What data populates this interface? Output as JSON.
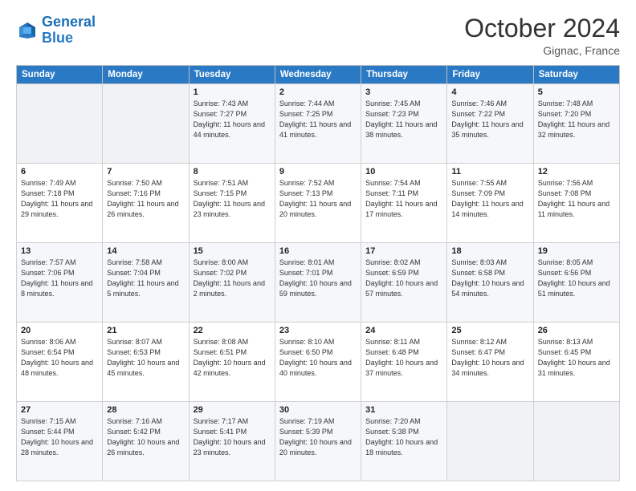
{
  "header": {
    "logo_line1": "General",
    "logo_line2": "Blue",
    "month": "October 2024",
    "location": "Gignac, France"
  },
  "columns": [
    "Sunday",
    "Monday",
    "Tuesday",
    "Wednesday",
    "Thursday",
    "Friday",
    "Saturday"
  ],
  "weeks": [
    [
      {
        "day": "",
        "info": ""
      },
      {
        "day": "",
        "info": ""
      },
      {
        "day": "1",
        "info": "Sunrise: 7:43 AM\nSunset: 7:27 PM\nDaylight: 11 hours and 44 minutes."
      },
      {
        "day": "2",
        "info": "Sunrise: 7:44 AM\nSunset: 7:25 PM\nDaylight: 11 hours and 41 minutes."
      },
      {
        "day": "3",
        "info": "Sunrise: 7:45 AM\nSunset: 7:23 PM\nDaylight: 11 hours and 38 minutes."
      },
      {
        "day": "4",
        "info": "Sunrise: 7:46 AM\nSunset: 7:22 PM\nDaylight: 11 hours and 35 minutes."
      },
      {
        "day": "5",
        "info": "Sunrise: 7:48 AM\nSunset: 7:20 PM\nDaylight: 11 hours and 32 minutes."
      }
    ],
    [
      {
        "day": "6",
        "info": "Sunrise: 7:49 AM\nSunset: 7:18 PM\nDaylight: 11 hours and 29 minutes."
      },
      {
        "day": "7",
        "info": "Sunrise: 7:50 AM\nSunset: 7:16 PM\nDaylight: 11 hours and 26 minutes."
      },
      {
        "day": "8",
        "info": "Sunrise: 7:51 AM\nSunset: 7:15 PM\nDaylight: 11 hours and 23 minutes."
      },
      {
        "day": "9",
        "info": "Sunrise: 7:52 AM\nSunset: 7:13 PM\nDaylight: 11 hours and 20 minutes."
      },
      {
        "day": "10",
        "info": "Sunrise: 7:54 AM\nSunset: 7:11 PM\nDaylight: 11 hours and 17 minutes."
      },
      {
        "day": "11",
        "info": "Sunrise: 7:55 AM\nSunset: 7:09 PM\nDaylight: 11 hours and 14 minutes."
      },
      {
        "day": "12",
        "info": "Sunrise: 7:56 AM\nSunset: 7:08 PM\nDaylight: 11 hours and 11 minutes."
      }
    ],
    [
      {
        "day": "13",
        "info": "Sunrise: 7:57 AM\nSunset: 7:06 PM\nDaylight: 11 hours and 8 minutes."
      },
      {
        "day": "14",
        "info": "Sunrise: 7:58 AM\nSunset: 7:04 PM\nDaylight: 11 hours and 5 minutes."
      },
      {
        "day": "15",
        "info": "Sunrise: 8:00 AM\nSunset: 7:02 PM\nDaylight: 11 hours and 2 minutes."
      },
      {
        "day": "16",
        "info": "Sunrise: 8:01 AM\nSunset: 7:01 PM\nDaylight: 10 hours and 59 minutes."
      },
      {
        "day": "17",
        "info": "Sunrise: 8:02 AM\nSunset: 6:59 PM\nDaylight: 10 hours and 57 minutes."
      },
      {
        "day": "18",
        "info": "Sunrise: 8:03 AM\nSunset: 6:58 PM\nDaylight: 10 hours and 54 minutes."
      },
      {
        "day": "19",
        "info": "Sunrise: 8:05 AM\nSunset: 6:56 PM\nDaylight: 10 hours and 51 minutes."
      }
    ],
    [
      {
        "day": "20",
        "info": "Sunrise: 8:06 AM\nSunset: 6:54 PM\nDaylight: 10 hours and 48 minutes."
      },
      {
        "day": "21",
        "info": "Sunrise: 8:07 AM\nSunset: 6:53 PM\nDaylight: 10 hours and 45 minutes."
      },
      {
        "day": "22",
        "info": "Sunrise: 8:08 AM\nSunset: 6:51 PM\nDaylight: 10 hours and 42 minutes."
      },
      {
        "day": "23",
        "info": "Sunrise: 8:10 AM\nSunset: 6:50 PM\nDaylight: 10 hours and 40 minutes."
      },
      {
        "day": "24",
        "info": "Sunrise: 8:11 AM\nSunset: 6:48 PM\nDaylight: 10 hours and 37 minutes."
      },
      {
        "day": "25",
        "info": "Sunrise: 8:12 AM\nSunset: 6:47 PM\nDaylight: 10 hours and 34 minutes."
      },
      {
        "day": "26",
        "info": "Sunrise: 8:13 AM\nSunset: 6:45 PM\nDaylight: 10 hours and 31 minutes."
      }
    ],
    [
      {
        "day": "27",
        "info": "Sunrise: 7:15 AM\nSunset: 5:44 PM\nDaylight: 10 hours and 28 minutes."
      },
      {
        "day": "28",
        "info": "Sunrise: 7:16 AM\nSunset: 5:42 PM\nDaylight: 10 hours and 26 minutes."
      },
      {
        "day": "29",
        "info": "Sunrise: 7:17 AM\nSunset: 5:41 PM\nDaylight: 10 hours and 23 minutes."
      },
      {
        "day": "30",
        "info": "Sunrise: 7:19 AM\nSunset: 5:39 PM\nDaylight: 10 hours and 20 minutes."
      },
      {
        "day": "31",
        "info": "Sunrise: 7:20 AM\nSunset: 5:38 PM\nDaylight: 10 hours and 18 minutes."
      },
      {
        "day": "",
        "info": ""
      },
      {
        "day": "",
        "info": ""
      }
    ]
  ]
}
